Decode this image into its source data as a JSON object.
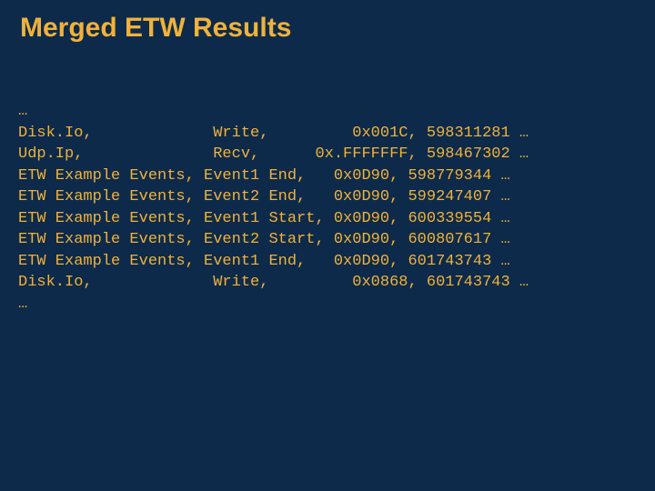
{
  "title": "Merged ETW Results",
  "lines": {
    "l0": "…",
    "l1": "Disk.Io,             Write,         0x001C, 598311281 …",
    "l2": "Udp.Ip,              Recv,      0x.FFFFFFF, 598467302 …",
    "l3": "ETW Example Events, Event1 End,   0x0D90, 598779344 …",
    "l4": "ETW Example Events, Event2 End,   0x0D90, 599247407 …",
    "l5": "ETW Example Events, Event1 Start, 0x0D90, 600339554 …",
    "l6": "ETW Example Events, Event2 Start, 0x0D90, 600807617 …",
    "l7": "ETW Example Events, Event1 End,   0x0D90, 601743743 …",
    "l8": "Disk.Io,             Write,         0x0868, 601743743 …",
    "l9": "…"
  }
}
